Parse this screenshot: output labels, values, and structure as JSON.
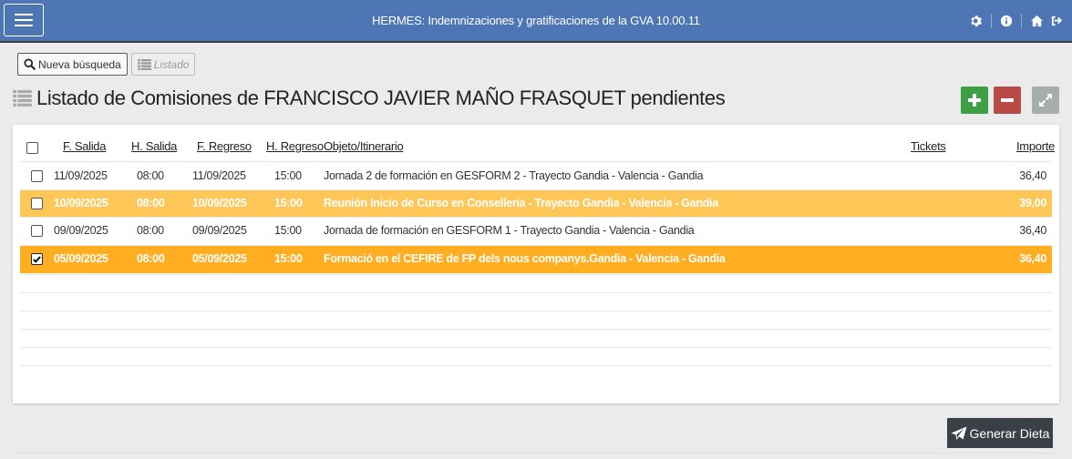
{
  "header": {
    "title": "HERMES: Indemnizaciones y gratificaciones de la GVA 10.00.11",
    "bg_color": "#4e76b4",
    "icons": [
      "gear-icon",
      "info-icon",
      "home-icon",
      "logout-icon"
    ]
  },
  "toolbar": {
    "new_search_label": "Nueva búsqueda",
    "listado_label": "Listado"
  },
  "page": {
    "title": "Listado de Comisiones de FRANCISCO JAVIER MAÑO FRASQUET pendientes"
  },
  "actions": {
    "add_color": "#3ea045",
    "remove_color": "#b84a45",
    "expand_color": "#a6aeab"
  },
  "table": {
    "columns": {
      "f_salida": "F. Salida",
      "h_salida": "H. Salida",
      "f_regreso": "F. Regreso",
      "h_regreso": "H. Regreso",
      "objeto": "Objeto/Itinerario",
      "tickets": "Tickets",
      "importe": "Importe"
    },
    "rows": [
      {
        "f_salida": "11/09/2025",
        "h_salida": "08:00",
        "f_regreso": "11/09/2025",
        "h_regreso": "15:00",
        "objeto": "Jornada 2 de formación en GESFORM 2 - Trayecto Gandia - Valencia - Gandia",
        "tickets": "",
        "importe": "36,40",
        "checked": false
      },
      {
        "f_salida": "10/09/2025",
        "h_salida": "08:00",
        "f_regreso": "10/09/2025",
        "h_regreso": "15:00",
        "objeto": "Reunión Inicio de Curso en Conselleria - Trayecto Gandia - Valencia - Gandia",
        "tickets": "",
        "importe": "39,00",
        "checked": false
      },
      {
        "f_salida": "09/09/2025",
        "h_salida": "08:00",
        "f_regreso": "09/09/2025",
        "h_regreso": "15:00",
        "objeto": "Jornada de formación en GESFORM 1 - Trayecto Gandia - Valencia - Gandia",
        "tickets": "",
        "importe": "36,40",
        "checked": false
      },
      {
        "f_salida": "05/09/2025",
        "h_salida": "08:00",
        "f_regreso": "05/09/2025",
        "h_regreso": "15:00",
        "objeto": "Formació en el CEFIRE de FP dels nous companys.Gandia - Valencia - Gandia",
        "tickets": "",
        "importe": "36,40",
        "checked": true
      }
    ],
    "highlight_color": "#ffc658",
    "selected_color": "#ffad21"
  },
  "footer": {
    "generate_label": "Generar Dieta"
  }
}
